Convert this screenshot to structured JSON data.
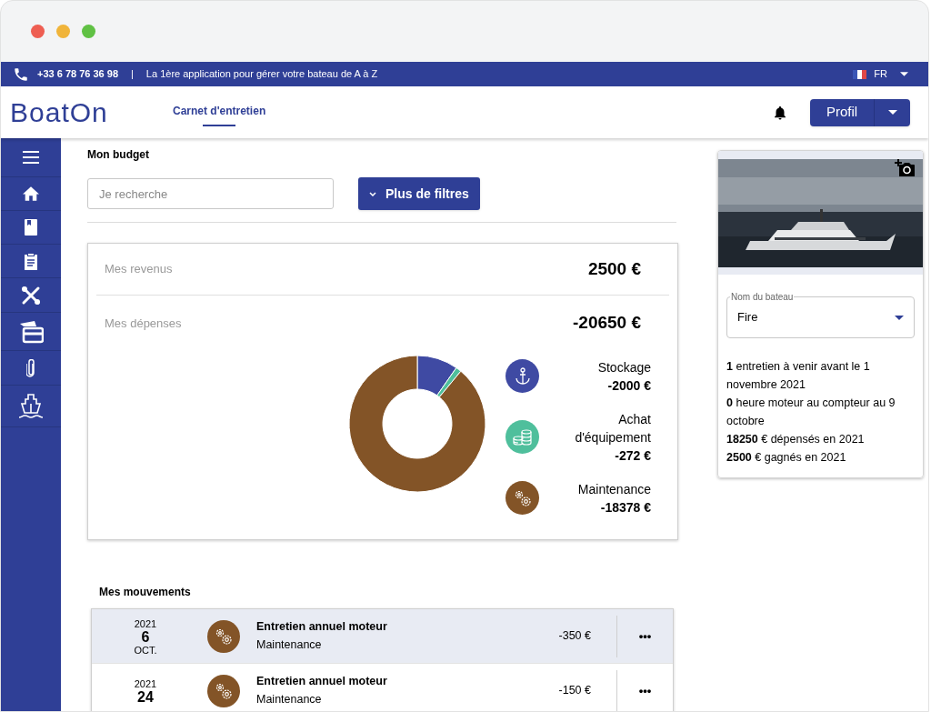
{
  "topbar": {
    "phone": "+33 6 78 76 36 98",
    "separator": "|",
    "tagline": "La 1ère application pour gérer votre bateau de A à Z",
    "language": "FR"
  },
  "header": {
    "logo": "BoatOn",
    "tabs": [
      {
        "label": "Carnet d'entretien",
        "selected": true
      }
    ],
    "profile_button": "Profil"
  },
  "budget": {
    "title": "Mon budget",
    "search": {
      "placeholder": "Je recherche"
    },
    "filter_button": "Plus de filtres",
    "revenue": {
      "label": "Mes revenus",
      "amount": "2500 €"
    },
    "expenses": {
      "label": "Mes dépenses",
      "amount": "-20650 €"
    },
    "chart_data": {
      "type": "donut",
      "categories": [
        "Stockage",
        "Achat d'équipement",
        "Maintenance"
      ],
      "values": [
        9.69,
        1.32,
        88.99
      ]
    },
    "legend": [
      {
        "kind": "anchor",
        "amount": "-2000 €",
        "color": "#3f4aa3"
      },
      {
        "kind": "coins",
        "amount": "-272 €",
        "color": "#4fbf9c"
      },
      {
        "kind": "gears",
        "amount": "-18378 €",
        "color": "#835427"
      }
    ]
  },
  "boat_card": {
    "field_label": "Nom du bateau",
    "field_value": "Fire",
    "facts": [
      "**1** entretien à venir avant le 1 novembre 2021",
      "**0** heure moteur au compteur au 9 octobre",
      "**18250** € dépensés en 2021",
      "**2500** € gagnés en 2021"
    ]
  },
  "movements": {
    "title": "Mes mouvements",
    "rows": [
      {
        "year": "2021",
        "day": "6",
        "month": "OCT.",
        "title": "Entretien annuel moteur",
        "category": "Maintenance",
        "amount": "-350 €",
        "more": "•••",
        "selected": true
      },
      {
        "year": "2021",
        "day": "24",
        "title": "Entretien annuel moteur",
        "category": "Maintenance",
        "amount": "-150 €",
        "more": "•••",
        "selected": false
      }
    ]
  }
}
